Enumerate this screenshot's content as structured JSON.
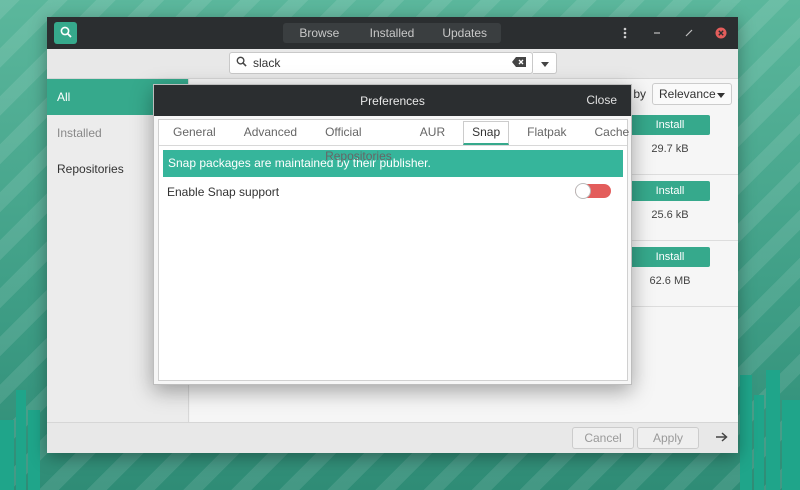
{
  "header": {
    "tabs": [
      {
        "label": "Browse"
      },
      {
        "label": "Installed"
      },
      {
        "label": "Updates"
      }
    ]
  },
  "search": {
    "value": "slack"
  },
  "sidebar": {
    "items": [
      {
        "label": "All"
      },
      {
        "label": "Installed"
      },
      {
        "label": "Repositories"
      }
    ]
  },
  "sort": {
    "label": "by",
    "value": "Relevance"
  },
  "packages": [
    {
      "action": "Install",
      "size": "29.7 kB"
    },
    {
      "action": "Install",
      "size": "25.6 kB"
    },
    {
      "action": "Install",
      "size": "62.6 MB"
    }
  ],
  "footer": {
    "cancel": "Cancel",
    "apply": "Apply"
  },
  "preferences": {
    "title": "Preferences",
    "close": "Close",
    "tabs": [
      {
        "label": "General"
      },
      {
        "label": "Advanced"
      },
      {
        "label": "Official Repositories"
      },
      {
        "label": "AUR"
      },
      {
        "label": "Snap"
      },
      {
        "label": "Flatpak"
      },
      {
        "label": "Cache"
      }
    ],
    "active_tab": "Snap",
    "banner": "Snap packages are maintained by their publisher.",
    "snap_label": "Enable Snap support",
    "snap_enabled": false
  },
  "colors": {
    "accent": "#36a98c",
    "toggle_off": "#e35d5b",
    "titlebar": "#2b2e30"
  }
}
